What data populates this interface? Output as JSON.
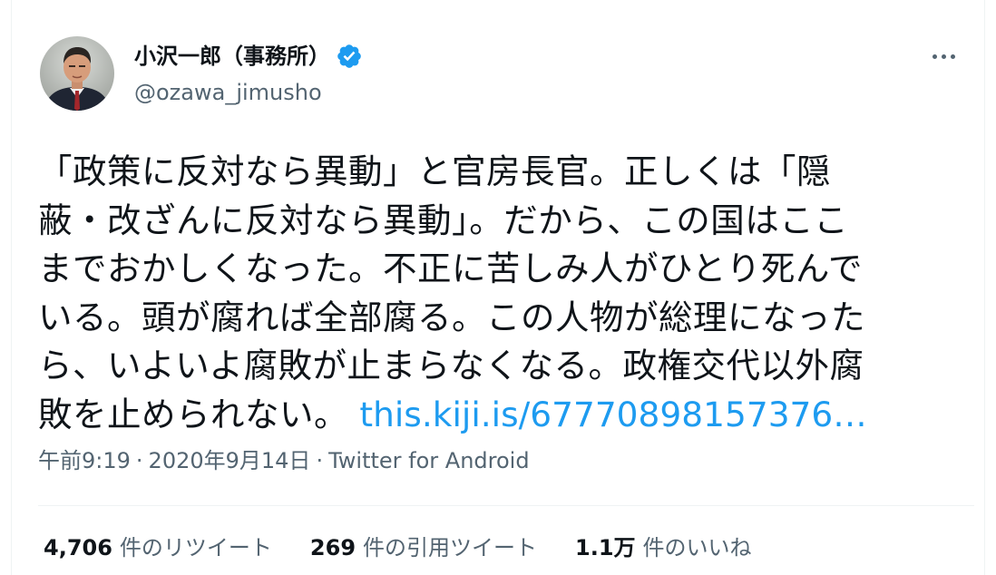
{
  "user": {
    "display_name": "小沢一郎（事務所）",
    "handle": "@ozawa_jimusho",
    "verified_icon": "verified-badge-icon"
  },
  "more_icon": "more-options-icon",
  "tweet": {
    "text": "「政策に反対なら異動」と官房長官。正しくは「隠\n蔽・改ざんに反対なら異動」。だから、この国はここ\nまでおかしくなった。不正に苦しみ人がひとり死んで\nいる。頭が腐れば全部腐る。この人物が総理になった\nら、いよいよ腐敗が止まらなくなる。政権交代以外腐\n敗を止められない。 ",
    "link": "this.kiji.is/67770898157376…"
  },
  "meta": {
    "time": "午前9:19",
    "sep1": "·",
    "date": "2020年9月14日",
    "sep2": "·",
    "source": "Twitter for Android"
  },
  "stats": {
    "retweets_count": "4,706",
    "retweets_label": "件のリツイート",
    "quotes_count": "269",
    "quotes_label": "件の引用ツイート",
    "likes_count": "1.1万",
    "likes_label": "件のいいね"
  },
  "colors": {
    "text": "#0f1419",
    "secondary": "#536471",
    "link": "#1d9bf0",
    "divider": "#eff3f4"
  }
}
